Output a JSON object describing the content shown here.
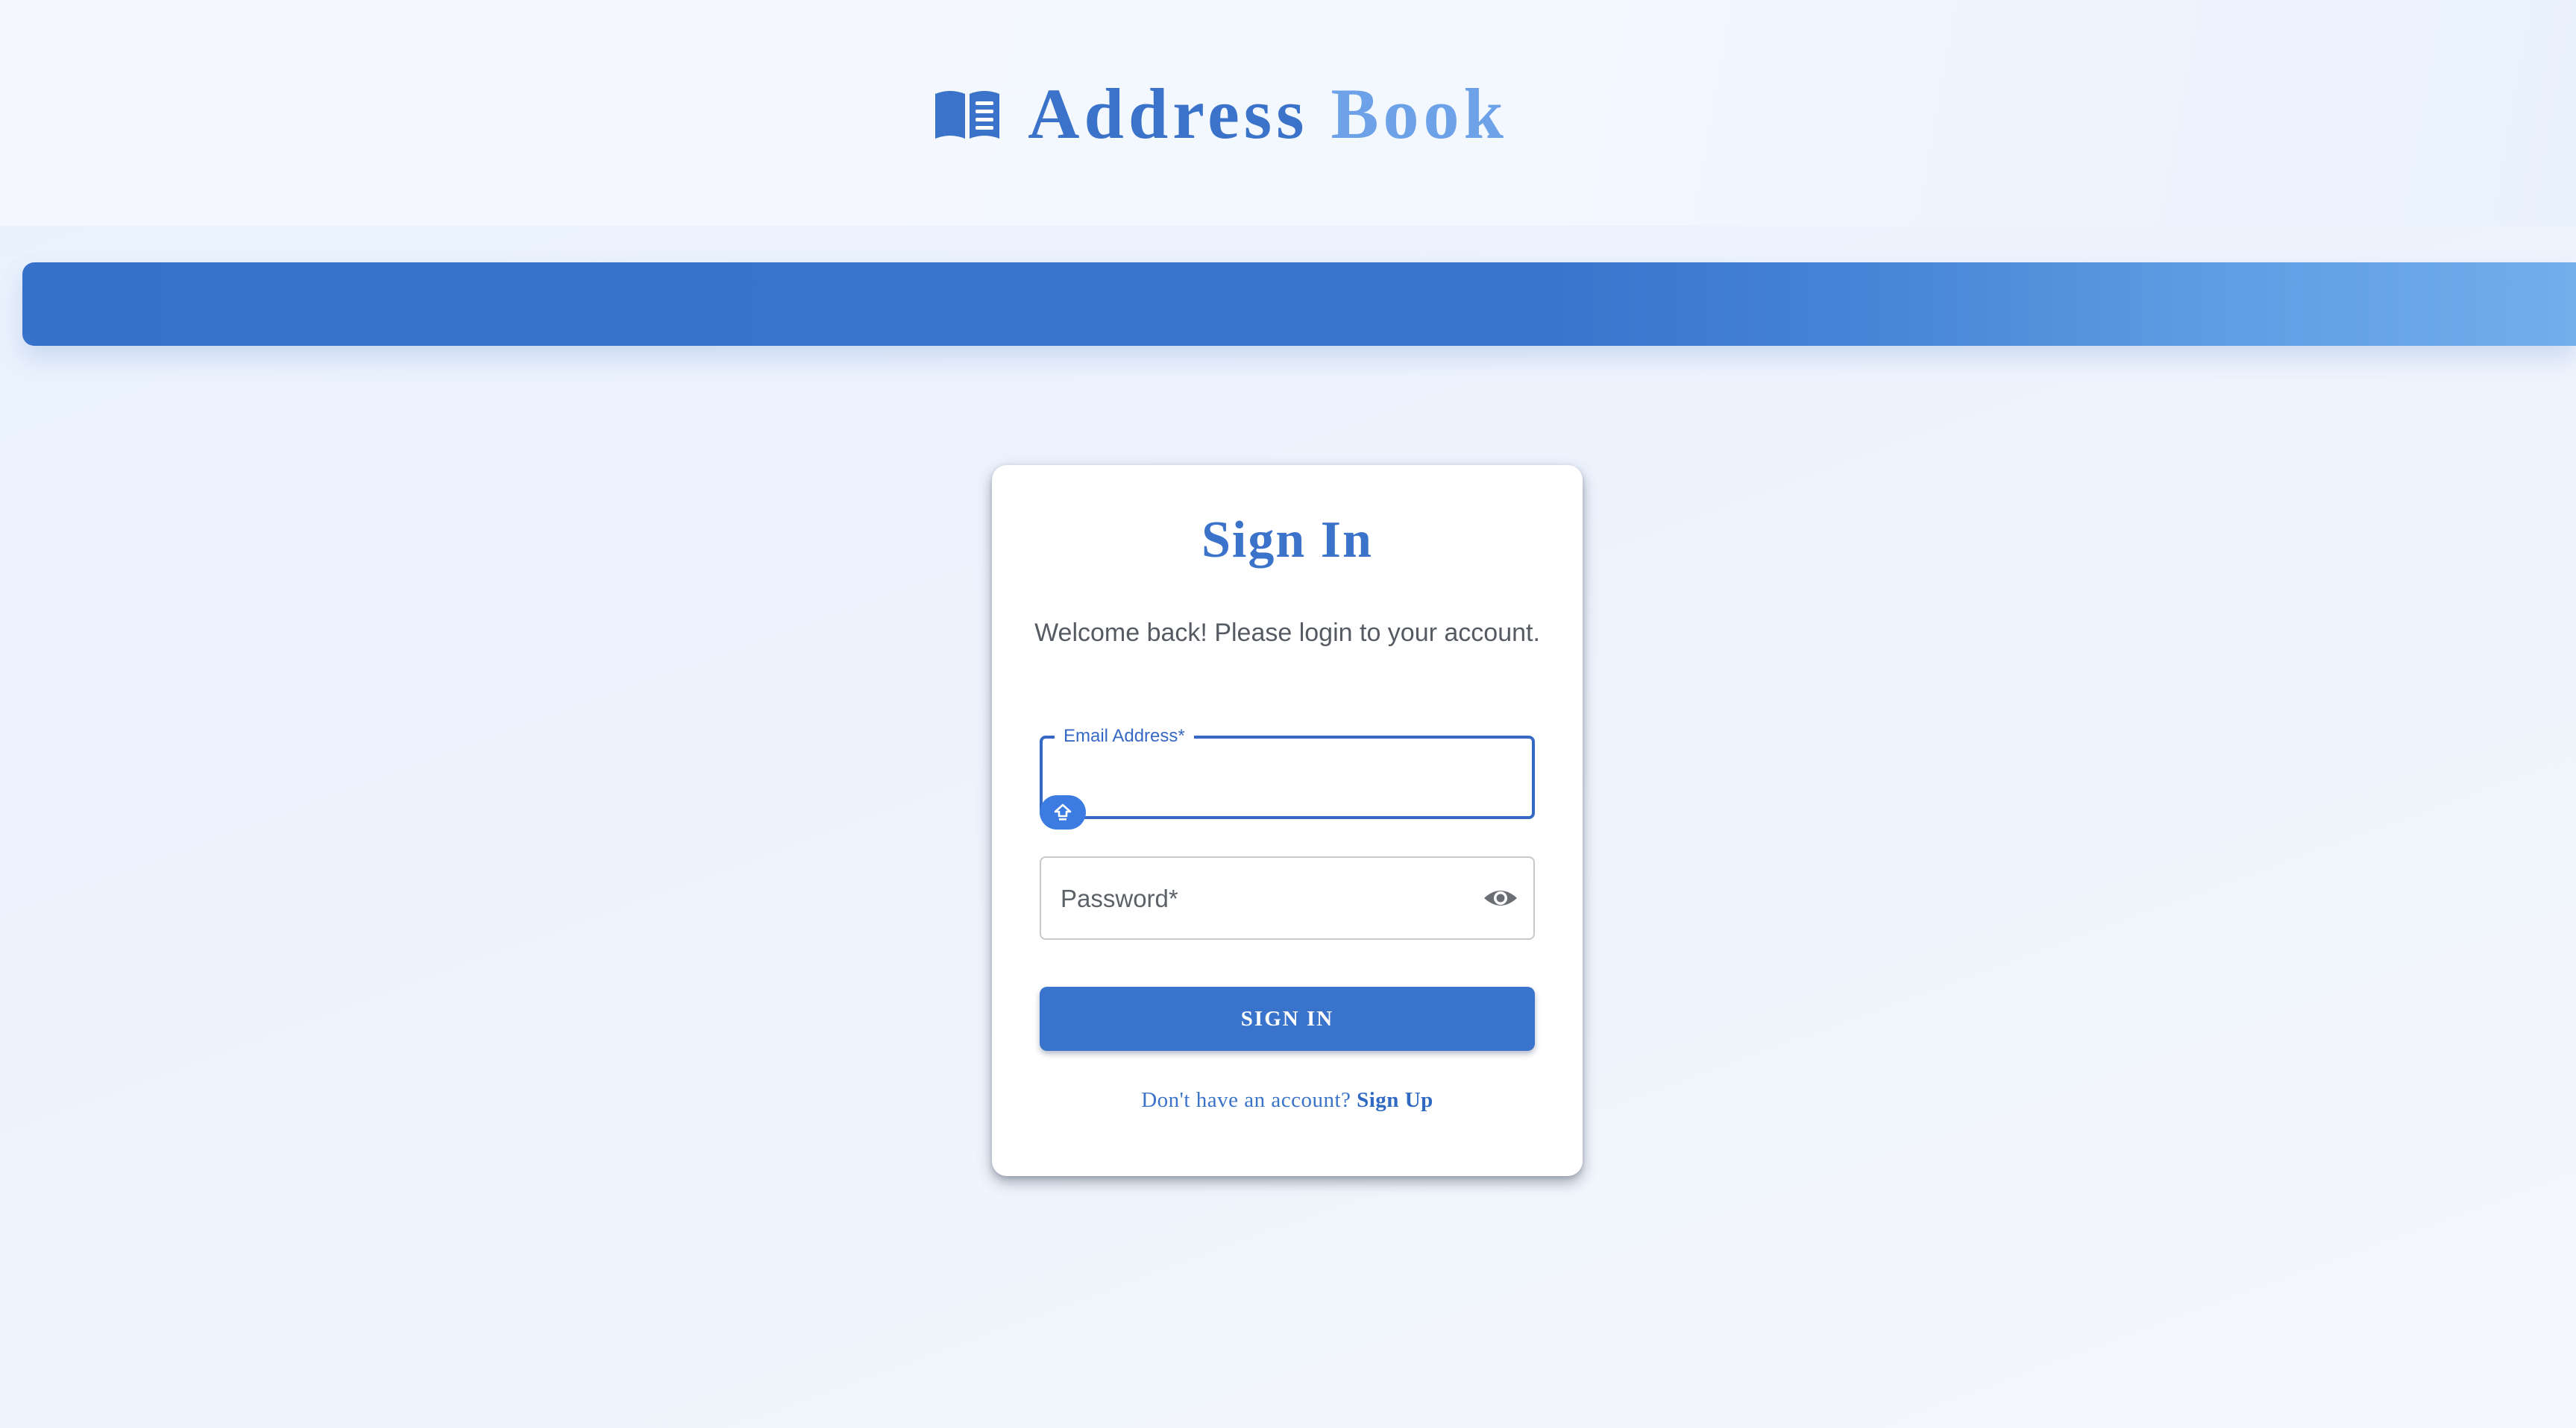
{
  "header": {
    "title_word_1": "Address",
    "title_word_2": "Book",
    "icon": "book-open-icon"
  },
  "login": {
    "title": "Sign In",
    "subtitle": "Welcome back! Please login to your account.",
    "email": {
      "label": "Email Address",
      "required_mark": "*",
      "value": "",
      "state": "focused",
      "autofill_icon": "autofill-key-icon"
    },
    "password": {
      "label": "Password",
      "required_mark": "*",
      "value": "",
      "toggle_icon": "eye-icon"
    },
    "submit_label": "SIGN IN",
    "signup_prompt": "Don't have an account?",
    "signup_link": "Sign Up"
  },
  "colors": {
    "primary": "#3a73c9",
    "primary_light": "#6ea2e8",
    "banner_start": "#3771ca",
    "banner_end": "#72aeec",
    "focus_outline": "#3669c4",
    "text_muted": "#565b63"
  }
}
